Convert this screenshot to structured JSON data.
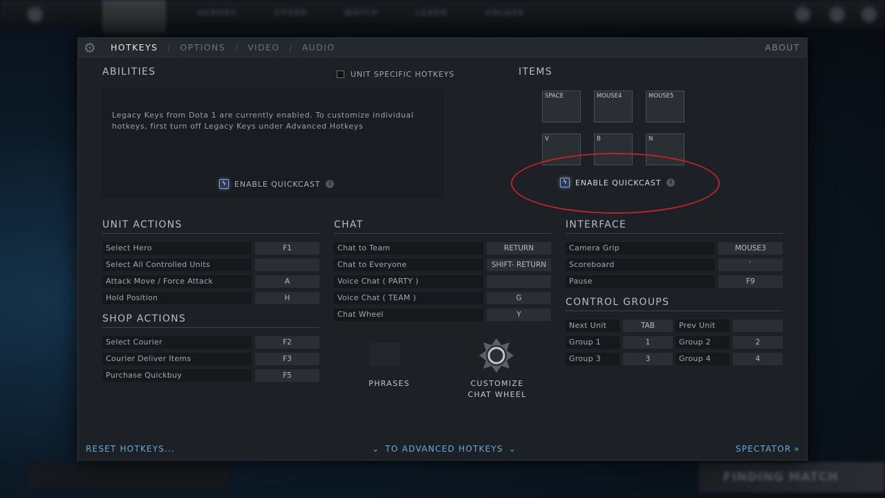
{
  "background": {
    "nav": [
      "HEROES",
      "STORE",
      "WATCH",
      "LEARN",
      "ARCADE"
    ],
    "finding_match": "FINDING MATCH"
  },
  "tabs": [
    "HOTKEYS",
    "OPTIONS",
    "VIDEO",
    "AUDIO"
  ],
  "tab_separator": "/",
  "about": "ABOUT",
  "abilities": {
    "title": "ABILITIES",
    "unit_specific_label": "UNIT SPECIFIC HOTKEYS",
    "message": "Legacy Keys from Dota 1 are currently enabled. To customize individual hotkeys, first turn off Legacy Keys under Advanced Hotkeys",
    "quickcast_label": "ENABLE QUICKCAST"
  },
  "items": {
    "title": "ITEMS",
    "slots": [
      "SPACE",
      "MOUSE4",
      "MOUSE5",
      "V",
      "B",
      "N"
    ],
    "quickcast_label": "ENABLE QUICKCAST"
  },
  "unit_actions": {
    "title": "UNIT ACTIONS",
    "rows": [
      {
        "name": "Select Hero",
        "key": "F1"
      },
      {
        "name": "Select All Controlled Units",
        "key": ""
      },
      {
        "name": "Attack Move / Force Attack",
        "key": "A"
      },
      {
        "name": "Hold Position",
        "key": "H"
      }
    ]
  },
  "shop_actions": {
    "title": "SHOP ACTIONS",
    "rows": [
      {
        "name": "Select Courier",
        "key": "F2"
      },
      {
        "name": "Courier Deliver Items",
        "key": "F3"
      },
      {
        "name": "Purchase Quickbuy",
        "key": "F5"
      }
    ]
  },
  "chat": {
    "title": "CHAT",
    "rows": [
      {
        "name": "Chat to Team",
        "key": "RETURN"
      },
      {
        "name": "Chat to Everyone",
        "key": "SHIFT- RETURN"
      },
      {
        "name": "Voice Chat ( PARTY )",
        "key": ""
      },
      {
        "name": "Voice Chat ( TEAM )",
        "key": "G"
      },
      {
        "name": "Chat Wheel",
        "key": "Y"
      }
    ],
    "phrases_label": "PHRASES",
    "customize_label_1": "CUSTOMIZE",
    "customize_label_2": "CHAT WHEEL"
  },
  "interface": {
    "title": "INTERFACE",
    "rows": [
      {
        "name": "Camera Grip",
        "key": "MOUSE3"
      },
      {
        "name": "Scoreboard",
        "key": "`"
      },
      {
        "name": "Pause",
        "key": "F9"
      }
    ]
  },
  "control_groups": {
    "title": "CONTROL GROUPS",
    "rows": [
      {
        "name": "Next Unit",
        "key": "TAB",
        "name2": "Prev Unit",
        "key2": ""
      },
      {
        "name": "Group 1",
        "key": "1",
        "name2": "Group 2",
        "key2": "2"
      },
      {
        "name": "Group 3",
        "key": "3",
        "name2": "Group 4",
        "key2": "4"
      }
    ]
  },
  "footer": {
    "reset": "RESET HOTKEYS...",
    "advanced": "TO ADVANCED HOTKEYS",
    "spectator": "SPECTATOR"
  },
  "colors": {
    "accent_link": "#6fa8d6",
    "highlight_circle": "#c0232a",
    "panel_bg": "#1d2125"
  },
  "icons": {
    "gear": "gear-icon",
    "quickcast": "lightning-icon",
    "info": "info-icon",
    "phrases": "speech-bubble-icon",
    "chat_wheel": "chat-wheel-icon",
    "chevron": "chevron-down-icon",
    "double_chevron": "double-chevron-right-icon"
  }
}
